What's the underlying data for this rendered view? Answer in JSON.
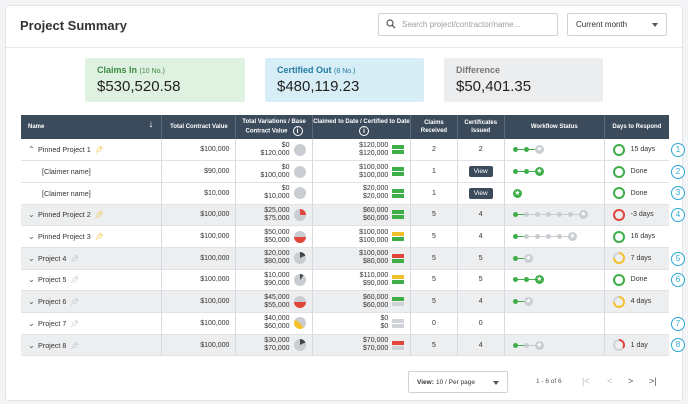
{
  "header": {
    "title": "Project Summary",
    "search_placeholder": "Search project/contractor/name...",
    "period": "Current month"
  },
  "summary": {
    "claims_in": {
      "label": "Claims In",
      "count": "(10 No.)",
      "amount": "$530,520.58"
    },
    "certified_out": {
      "label": "Certified Out",
      "count": "(8 No.)",
      "amount": "$480,119.23"
    },
    "difference": {
      "label": "Difference",
      "amount": "$50,401.35"
    }
  },
  "columns": [
    "Name",
    "Total Contract Value",
    "Total Variations / Base Contract Value",
    "Claimed to Date / Certified to Date",
    "Claims Received",
    "Certificates Issued",
    "Workflow Status",
    "Days to Respond"
  ],
  "rows": [
    {
      "name": "Pinned Project 1",
      "chev": "^",
      "pin": "on",
      "indent": false,
      "shade": false,
      "tcv": "$100,000",
      "var": "$0",
      "base": "$120,000",
      "pie": "none",
      "claimed": "$120,000",
      "cert": "$120,000",
      "bars": [
        "g",
        "g"
      ],
      "received": "2",
      "issued": "2",
      "view": false,
      "wf": {
        "done": 2,
        "pending": 0,
        "end": "grey"
      },
      "ring": "green",
      "days": "15 days",
      "callout": "1"
    },
    {
      "name": "[Claimer name]",
      "chev": "",
      "pin": "",
      "indent": true,
      "shade": false,
      "tcv": "$90,000",
      "var": "$0",
      "base": "$100,000",
      "pie": "none",
      "claimed": "$100,000",
      "cert": "$100,000",
      "bars": [
        "g",
        "g"
      ],
      "received": "1",
      "issued": "View",
      "view": true,
      "wf": {
        "done": 2,
        "pending": 0,
        "end": "green"
      },
      "ring": "green",
      "days": "Done",
      "callout": "2"
    },
    {
      "name": "[Claimer name]",
      "chev": "",
      "pin": "",
      "indent": true,
      "shade": false,
      "tcv": "$10,000",
      "var": "$0",
      "base": "$10,000",
      "pie": "none",
      "claimed": "$20,000",
      "cert": "$20,000",
      "bars": [
        "g",
        "g"
      ],
      "received": "1",
      "issued": "View",
      "view": true,
      "wf": {
        "done": 0,
        "pending": 0,
        "end": "green"
      },
      "ring": "green",
      "days": "Done",
      "callout": "3"
    },
    {
      "name": "Pinned Project 2",
      "chev": "v",
      "pin": "on",
      "indent": false,
      "shade": true,
      "tcv": "$100,000",
      "var": "$25,000",
      "base": "$75,000",
      "pie": "red",
      "claimed": "$60,000",
      "cert": "$60,000",
      "bars": [
        "g",
        "g"
      ],
      "received": "5",
      "issued": "4",
      "view": false,
      "wf": {
        "done": 1,
        "pending": 5,
        "end": "grey"
      },
      "ring": "red",
      "days": "-3 days",
      "callout": "4"
    },
    {
      "name": "Pinned Project 3",
      "chev": "v",
      "pin": "on",
      "indent": false,
      "shade": false,
      "tcv": "$100,000",
      "var": "$50,000",
      "base": "$50,000",
      "pie": "red-half",
      "claimed": "$100,000",
      "cert": "$100,000",
      "bars": [
        "y",
        "g"
      ],
      "received": "5",
      "issued": "4",
      "view": false,
      "wf": {
        "done": 1,
        "pending": 4,
        "end": "grey"
      },
      "ring": "green",
      "days": "16 days",
      "callout": ""
    },
    {
      "name": "Project 4",
      "chev": "v",
      "pin": "off",
      "indent": false,
      "shade": true,
      "tcv": "$100,000",
      "var": "$20,000",
      "base": "$80,000",
      "pie": "dark",
      "claimed": "$100,000",
      "cert": "$80,000",
      "bars": [
        "r",
        "g"
      ],
      "received": "5",
      "issued": "5",
      "view": false,
      "wf": {
        "done": 1,
        "pending": 0,
        "end": "grey"
      },
      "ring": "yellow",
      "days": "7 days",
      "callout": "5"
    },
    {
      "name": "Project 5",
      "chev": "v",
      "pin": "off",
      "indent": false,
      "shade": false,
      "tcv": "$100,000",
      "var": "$10,000",
      "base": "$90,000",
      "pie": "dark-small",
      "claimed": "$110,000",
      "cert": "$90,000",
      "bars": [
        "y",
        "g"
      ],
      "received": "5",
      "issued": "5",
      "view": false,
      "wf": {
        "done": 2,
        "pending": 0,
        "end": "green"
      },
      "ring": "green",
      "days": "Done",
      "callout": "6"
    },
    {
      "name": "Project 6",
      "chev": "v",
      "pin": "off",
      "indent": false,
      "shade": true,
      "tcv": "$100,000",
      "var": "$45,000",
      "base": "$55,000",
      "pie": "red-half",
      "claimed": "$60,000",
      "cert": "$60,000",
      "bars": [
        "g",
        "n"
      ],
      "received": "5",
      "issued": "4",
      "view": false,
      "wf": {
        "done": 1,
        "pending": 0,
        "end": "grey"
      },
      "ring": "yellow",
      "days": "4 days",
      "callout": ""
    },
    {
      "name": "Project 7",
      "chev": "v",
      "pin": "off",
      "indent": false,
      "shade": false,
      "tcv": "$100,000",
      "var": "$40,000",
      "base": "$60,000",
      "pie": "yellow",
      "claimed": "$0",
      "cert": "$0",
      "bars": [
        "n",
        "n"
      ],
      "received": "0",
      "issued": "0",
      "view": false,
      "wf": null,
      "ring": "",
      "days": "",
      "callout": "7"
    },
    {
      "name": "Project 8",
      "chev": "v",
      "pin": "off",
      "indent": false,
      "shade": true,
      "tcv": "$100,000",
      "var": "$30,000",
      "base": "$70,000",
      "pie": "dark",
      "claimed": "$70,000",
      "cert": "$70,000",
      "bars": [
        "r",
        "n"
      ],
      "received": "5",
      "issued": "4",
      "view": false,
      "wf": {
        "done": 1,
        "pending": 1,
        "end": "grey"
      },
      "ring": "red-small",
      "days": "1 day",
      "callout": "8"
    }
  ],
  "footer": {
    "view_label": "View:",
    "per_page": "10 / Per page",
    "range": "1 - 6 of 6",
    "first": "|<",
    "prev": "<",
    "next": ">",
    "last": ">|"
  },
  "colors": {
    "green": "#3dae48",
    "red": "#e2453c",
    "yellow": "#f2c02b",
    "header": "#3b4b5c",
    "accent": "#2aa9d4"
  }
}
